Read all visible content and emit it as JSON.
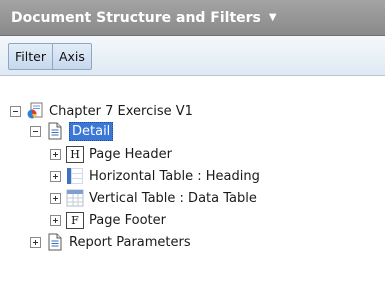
{
  "header": {
    "title": "Document Structure and Filters",
    "menu_arrow": "▼"
  },
  "toolbar": {
    "tabs": [
      {
        "label": "Filter"
      },
      {
        "label": "Axis"
      }
    ]
  },
  "tree": {
    "root": {
      "label": "Chapter 7 Exercise V1",
      "icon": "report-icon",
      "expanded": true
    },
    "detail": {
      "label": "Detail",
      "icon": "document-icon",
      "expanded": true,
      "selected": true
    },
    "children": [
      {
        "label": "Page Header",
        "icon": "page-header-icon",
        "glyph": "H"
      },
      {
        "label": "Horizontal Table : Heading",
        "icon": "horizontal-table-icon"
      },
      {
        "label": "Vertical Table : Data Table",
        "icon": "vertical-table-icon"
      },
      {
        "label": "Page Footer",
        "icon": "page-footer-icon",
        "glyph": "F"
      }
    ],
    "report_parameters": {
      "label": "Report Parameters",
      "icon": "document-icon",
      "expanded": false
    }
  },
  "colors": {
    "header_bg": "#999999",
    "toolbar_bg": "#dfe9f3",
    "selection": "#3b78d6"
  }
}
